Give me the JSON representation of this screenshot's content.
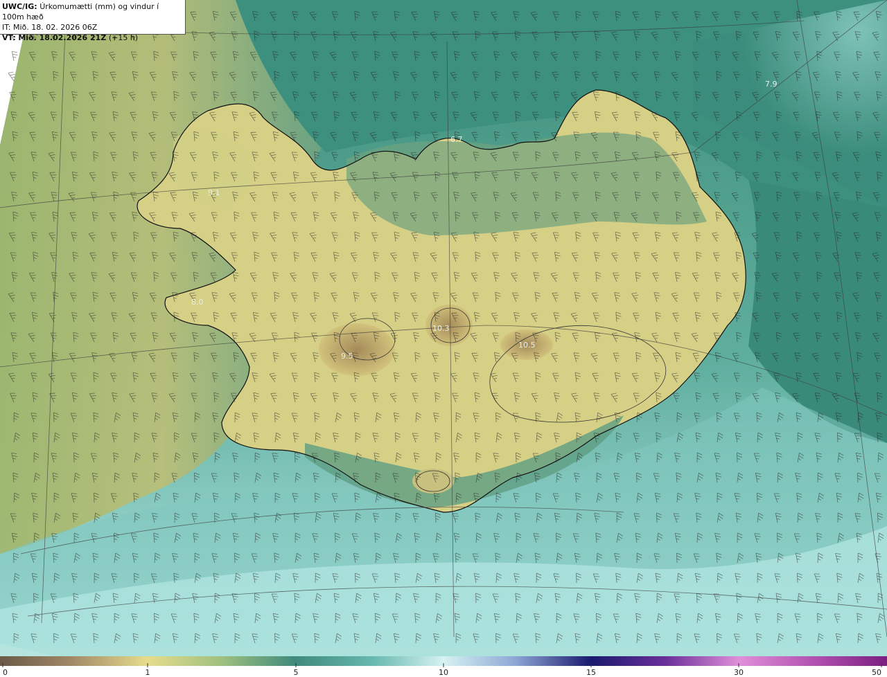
{
  "header": {
    "product": "UWC/IG:",
    "description": "Úrkomumætti (mm) og vindur í 100m hæð",
    "init_time": "IT: Mið. 18. 02. 2026 06Z",
    "valid_label": "VT:",
    "valid_time": "Mið. 18.02.2026 21Z",
    "lead_time": "(+15 h)"
  },
  "map_labels": [
    {
      "text": "7.9"
    },
    {
      "text": "6.7"
    },
    {
      "text": "9.1"
    },
    {
      "text": "8.0"
    },
    {
      "text": "10.3"
    },
    {
      "text": "10.5"
    },
    {
      "text": "9.5"
    }
  ],
  "colorbar": {
    "ticks": [
      "0",
      "1",
      "5",
      "10",
      "15",
      "30",
      "50"
    ],
    "colors": [
      "#6b5a47",
      "#b89a6a",
      "#e6dc8c",
      "#3f8a7c",
      "#2e7b70",
      "#cfeef0",
      "#2f3a9a",
      "#1a1a6e",
      "#c84aa8",
      "#e08ad0",
      "#8c2a8c"
    ]
  },
  "colors": {
    "water_dark": "#2f7a70",
    "water_light": "#a7dfd8",
    "land_yellow": "#e3d98a",
    "land_brown": "#a88c5c",
    "coastline": "#111111"
  }
}
